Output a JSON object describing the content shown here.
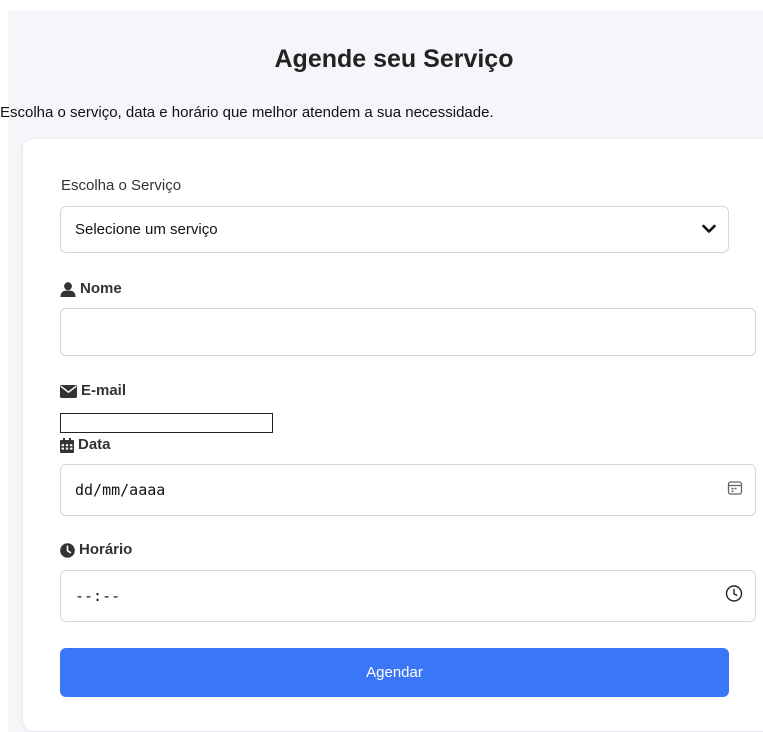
{
  "page": {
    "title": "Agende seu Serviço",
    "subtitle": "Escolha o serviço, data e horário que melhor atendem a sua necessidade."
  },
  "form": {
    "service": {
      "label": "Escolha o Serviço",
      "selected": "Selecione um serviço"
    },
    "name": {
      "label": "Nome",
      "icon": "user-icon",
      "value": ""
    },
    "email": {
      "label": "E-mail",
      "icon": "envelope-icon",
      "value": ""
    },
    "date": {
      "label": "Data",
      "icon": "calendar-icon",
      "value": "dd/mm/aaaa"
    },
    "time": {
      "label": "Horário",
      "icon": "clock-icon",
      "value": "--:--"
    },
    "submit_label": "Agendar"
  },
  "colors": {
    "background": "#f4f6fa",
    "card": "#ffffff",
    "button": "#3b76f6",
    "button_text": "#ffffff"
  }
}
